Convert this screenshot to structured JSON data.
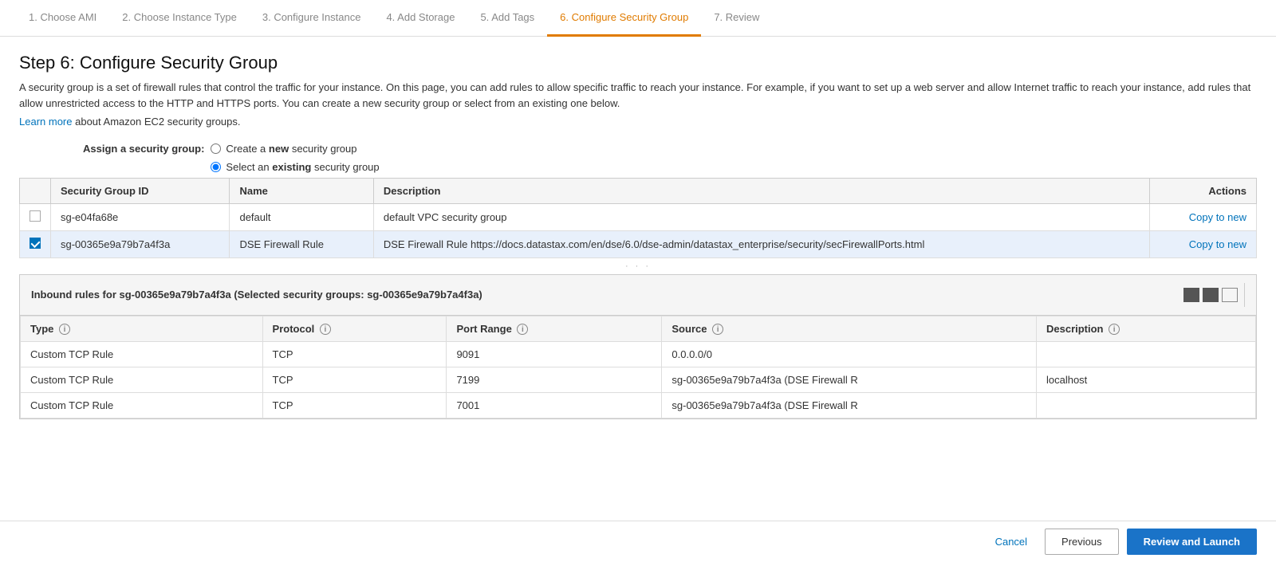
{
  "nav": {
    "steps": [
      {
        "id": "step1",
        "label": "1. Choose AMI",
        "state": "inactive"
      },
      {
        "id": "step2",
        "label": "2. Choose Instance Type",
        "state": "inactive"
      },
      {
        "id": "step3",
        "label": "3. Configure Instance",
        "state": "inactive"
      },
      {
        "id": "step4",
        "label": "4. Add Storage",
        "state": "inactive"
      },
      {
        "id": "step5",
        "label": "5. Add Tags",
        "state": "inactive"
      },
      {
        "id": "step6",
        "label": "6. Configure Security Group",
        "state": "active"
      },
      {
        "id": "step7",
        "label": "7. Review",
        "state": "inactive"
      }
    ]
  },
  "page": {
    "title": "Step 6: Configure Security Group",
    "description": "A security group is a set of firewall rules that control the traffic for your instance. On this page, you can add rules to allow specific traffic to reach your instance. For example, if you want to set up a web server and allow Internet traffic to reach your instance, add rules that allow unrestricted access to the HTTP and HTTPS ports. You can create a new security group or select from an existing one below.",
    "learn_more_text": "Learn more",
    "learn_more_suffix": " about Amazon EC2 security groups.",
    "assign_label": "Assign a security group:",
    "radio_new_label": "Create a ",
    "radio_new_bold": "new",
    "radio_new_suffix": " security group",
    "radio_existing_label": "Select an ",
    "radio_existing_bold": "existing",
    "radio_existing_suffix": " security group"
  },
  "sg_table": {
    "columns": [
      "",
      "Security Group ID",
      "Name",
      "Description",
      "Actions"
    ],
    "rows": [
      {
        "checked": false,
        "id": "sg-e04fa68e",
        "name": "default",
        "description": "default VPC security group",
        "action": "Copy to new",
        "selected": false
      },
      {
        "checked": true,
        "id": "sg-00365e9a79b7a4f3a",
        "name": "DSE Firewall Rule",
        "description": "DSE Firewall Rule https://docs.datastax.com/en/dse/6.0/dse-admin/datastax_enterprise/security/secFirewallPorts.html",
        "action": "Copy to new",
        "selected": true
      }
    ]
  },
  "inbound": {
    "header": "Inbound rules for sg-00365e9a79b7a4f3a (Selected security groups: sg-00365e9a79b7a4f3a)",
    "columns": [
      "Type",
      "Protocol",
      "Port Range",
      "Source",
      "Description"
    ],
    "rows": [
      {
        "type": "Custom TCP Rule",
        "protocol": "TCP",
        "port_range": "9091",
        "source": "0.0.0.0/0",
        "description": ""
      },
      {
        "type": "Custom TCP Rule",
        "protocol": "TCP",
        "port_range": "7199",
        "source": "sg-00365e9a79b7a4f3a (DSE Firewall R",
        "description": "localhost"
      },
      {
        "type": "Custom TCP Rule",
        "protocol": "TCP",
        "port_range": "7001",
        "source": "sg-00365e9a79b7a4f3a (DSE Firewall R",
        "description": ""
      }
    ]
  },
  "footer": {
    "cancel_label": "Cancel",
    "previous_label": "Previous",
    "review_label": "Review and Launch"
  }
}
